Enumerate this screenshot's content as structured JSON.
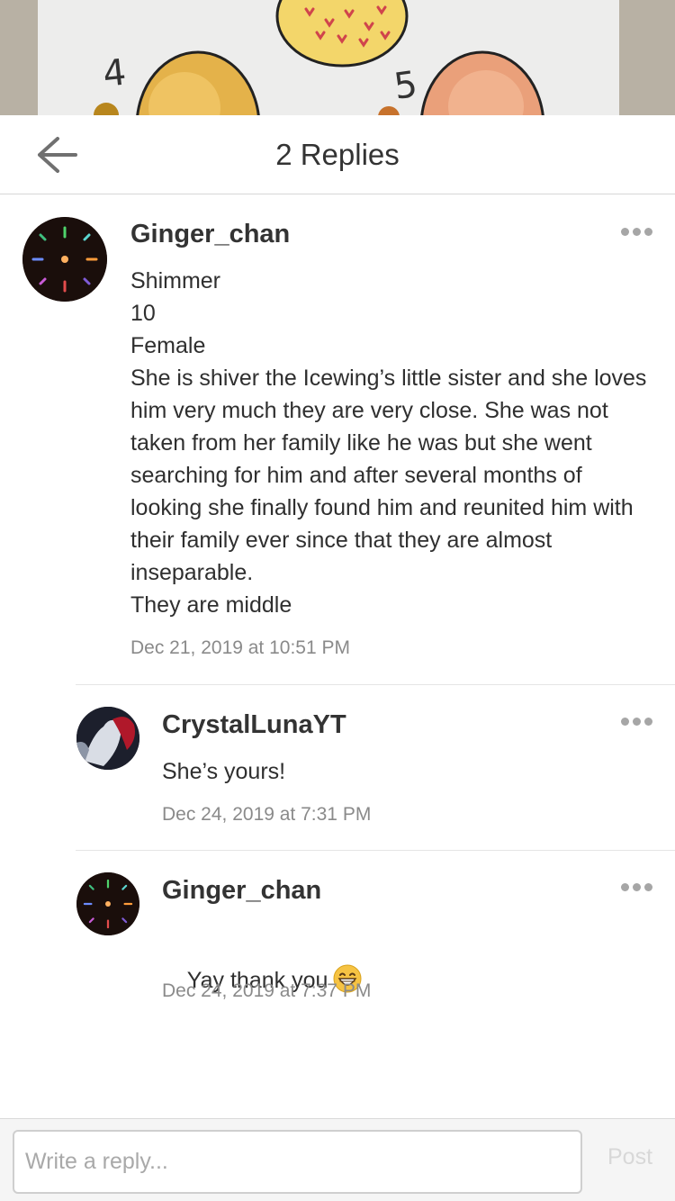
{
  "background": {
    "numbers": [
      "4",
      "5"
    ]
  },
  "header": {
    "title": "2 Replies",
    "back_icon": "arrow-left-icon"
  },
  "main_comment": {
    "author": "Ginger_chan",
    "body": "Shimmer\n10\nFemale\nShe is shiver the Icewing’s little sister and she loves him very much they are very close. She was not taken from her family like he was but she went searching for him and after several months of looking she finally found him and reunited him with their family ever since that they are almost inseparable.\nThey are middle",
    "timestamp": "Dec 21, 2019 at 10:51 PM",
    "more_icon": "more-dots-icon"
  },
  "replies": [
    {
      "author": "CrystalLunaYT",
      "body": "She’s yours!",
      "timestamp": "Dec 24, 2019 at 7:31 PM"
    },
    {
      "author": "Ginger_chan",
      "body": "Yay thank you",
      "emoji": "grinning-face-icon",
      "timestamp": "Dec 24, 2019 at 7:37 PM"
    }
  ],
  "reply_bar": {
    "placeholder": "Write a reply...",
    "post_label": "Post"
  },
  "colors": {
    "text": "#2b2b2b",
    "muted": "#8a8a8a",
    "post_disabled": "#d8d8d8"
  }
}
